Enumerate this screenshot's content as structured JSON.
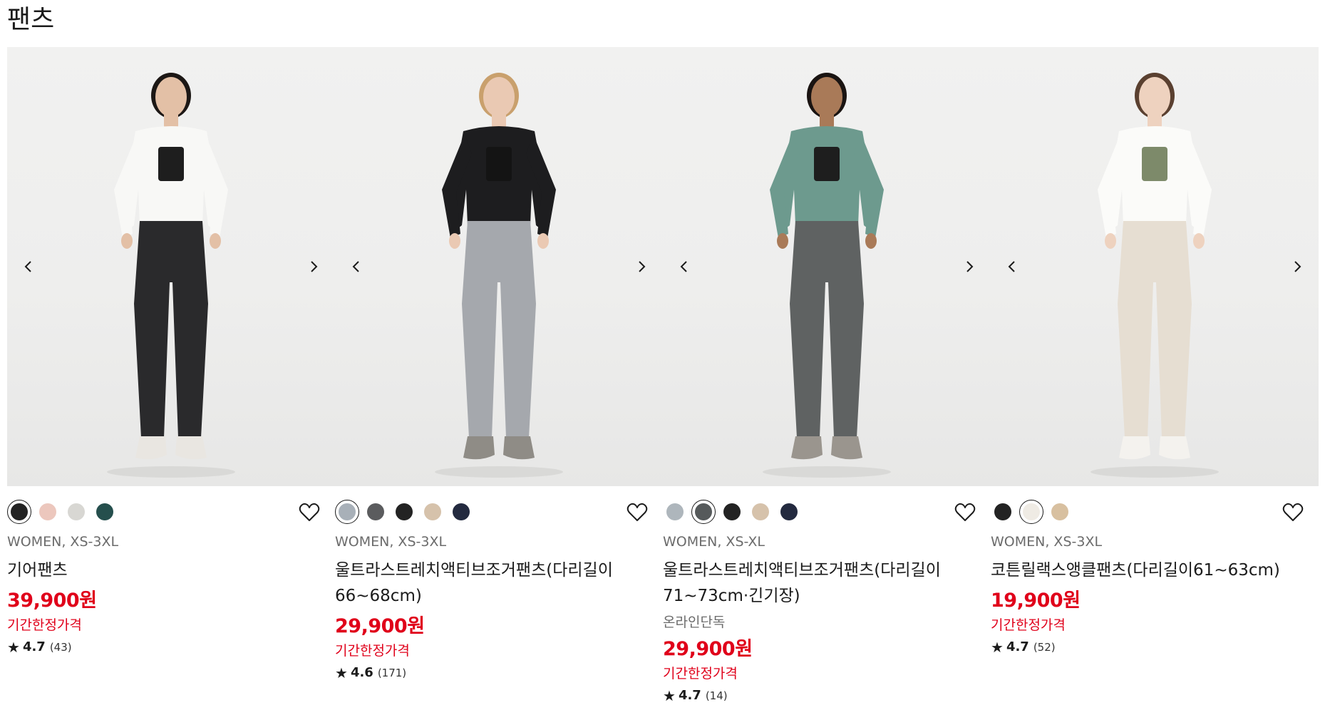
{
  "section_title": "팬츠",
  "products": [
    {
      "colors": [
        "#232323",
        "#ecc7bd",
        "#d8d7d3",
        "#254f4d"
      ],
      "selected_color": 0,
      "meta": "WOMEN, XS-3XL",
      "name": "기어팬츠",
      "exclusive": "",
      "price": "39,900원",
      "promo": "기간한정가격",
      "rating": "4.7",
      "reviews": "(43)",
      "model": {
        "skin": "#e3c0a6",
        "hair": "#1c1715",
        "top": "#f8f8f6",
        "inner": "#1e1e1e",
        "pants": "#2a2a2c",
        "shoes": "#e9e6e1"
      }
    },
    {
      "colors": [
        "#a8b0b8",
        "#5b5c5e",
        "#232323",
        "#d6c2ab",
        "#232a3f"
      ],
      "selected_color": 0,
      "meta": "WOMEN, XS-3XL",
      "name": "울트라스트레치액티브조거팬츠(다리길이66~68cm)",
      "exclusive": "",
      "price": "29,900원",
      "promo": "기간한정가격",
      "rating": "4.6",
      "reviews": "(171)",
      "model": {
        "skin": "#eac9b3",
        "hair": "#c9a06d",
        "top": "#1d1d1f",
        "inner": "#141414",
        "pants": "#a5a8ad",
        "shoes": "#8f8c86"
      }
    },
    {
      "colors": [
        "#aeb6bc",
        "#565a5b",
        "#232323",
        "#d6c2ab",
        "#232a3f"
      ],
      "selected_color": 1,
      "meta": "WOMEN, XS-XL",
      "name": "울트라스트레치액티브조거팬츠(다리길이71~73cm·긴기장)",
      "exclusive": "온라인단독",
      "price": "29,900원",
      "promo": "기간한정가격",
      "rating": "4.7",
      "reviews": "(14)",
      "model": {
        "skin": "#a97a58",
        "hair": "#1a1412",
        "top": "#6d9a8e",
        "inner": "#1e1e1e",
        "pants": "#5f6262",
        "shoes": "#9a958e"
      }
    },
    {
      "colors": [
        "#232323",
        "#efebe4",
        "#d8c0a0"
      ],
      "selected_color": 1,
      "meta": "WOMEN, XS-3XL",
      "name": "코튼릴랙스앵클팬츠(다리길이61~63cm)",
      "exclusive": "",
      "price": "19,900원",
      "promo": "기간한정가격",
      "rating": "4.7",
      "reviews": "(52)",
      "model": {
        "skin": "#eed2bf",
        "hair": "#5a4030",
        "top": "#fbfbf9",
        "inner": "#7d8a6a",
        "pants": "#e6ded2",
        "shoes": "#f4f2ee"
      }
    }
  ]
}
